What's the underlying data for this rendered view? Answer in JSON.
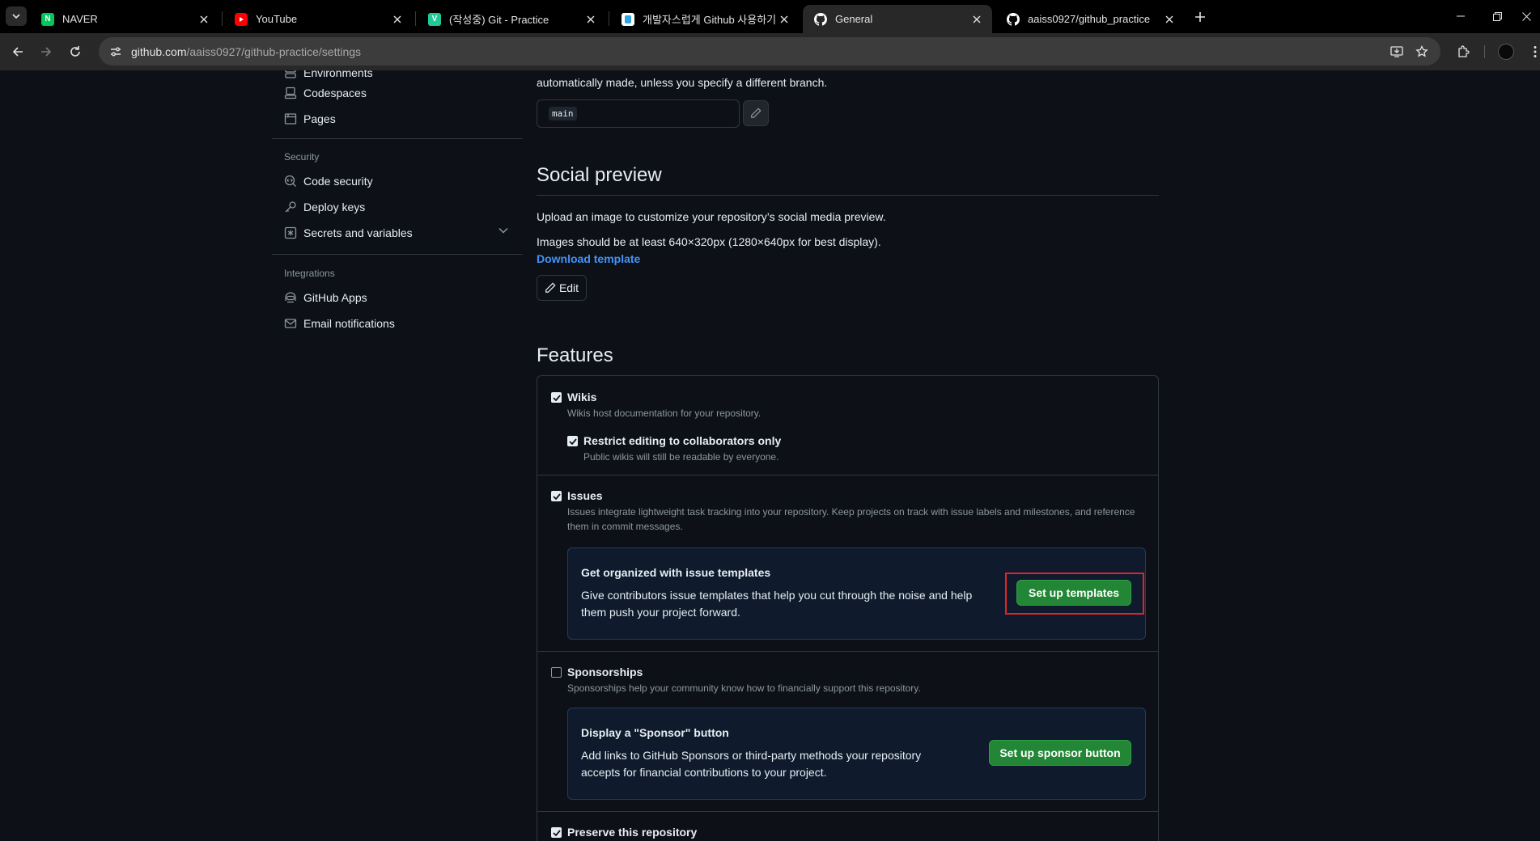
{
  "browser": {
    "tabs": [
      {
        "title": "NAVER",
        "favicon": "naver-icon",
        "color": "#03c75a",
        "active": false
      },
      {
        "title": "YouTube",
        "favicon": "youtube-icon",
        "color": "#ff0000",
        "active": false
      },
      {
        "title": "(작성중) Git - Practice",
        "favicon": "velog-icon",
        "color": "#20c997",
        "active": false
      },
      {
        "title": "개발자스럽게 Github 사용하기",
        "favicon": "blog-icon",
        "color": "#33a4e3",
        "active": false
      },
      {
        "title": "General",
        "favicon": "github-icon",
        "color": "#ffffff",
        "active": true
      },
      {
        "title": "aaiss0927/github_practice",
        "favicon": "github-icon",
        "color": "#ffffff",
        "active": false
      }
    ],
    "url_host": "github.com",
    "url_path": "/aaiss0927/github-practice/settings"
  },
  "sidebar": {
    "items_top": [
      {
        "label": "Environments",
        "icon": "server-icon"
      },
      {
        "label": "Codespaces",
        "icon": "codespaces-icon"
      },
      {
        "label": "Pages",
        "icon": "browser-icon"
      }
    ],
    "security_heading": "Security",
    "security_items": [
      {
        "label": "Code security",
        "icon": "codescan-icon"
      },
      {
        "label": "Deploy keys",
        "icon": "key-icon"
      },
      {
        "label": "Secrets and variables",
        "icon": "asterisk-icon"
      }
    ],
    "integrations_heading": "Integrations",
    "integration_items": [
      {
        "label": "GitHub Apps",
        "icon": "hubot-icon"
      },
      {
        "label": "Email notifications",
        "icon": "mail-icon"
      }
    ]
  },
  "default_branch": {
    "note": "automatically made, unless you specify a different branch.",
    "branch": "main"
  },
  "social_preview": {
    "title": "Social preview",
    "desc1": "Upload an image to customize your repository’s social media preview.",
    "desc2": "Images should be at least 640×320px (1280×640px for best display).",
    "download_link": "Download template",
    "edit_label": "Edit"
  },
  "features": {
    "title": "Features",
    "wikis": {
      "label": "Wikis",
      "checked": true,
      "desc": "Wikis host documentation for your repository.",
      "restrict_label": "Restrict editing to collaborators only",
      "restrict_desc": "Public wikis will still be readable by everyone."
    },
    "issues": {
      "label": "Issues",
      "checked": true,
      "desc": "Issues integrate lightweight task tracking into your repository. Keep projects on track with issue labels and milestones, and reference them in commit messages.",
      "promo_title": "Get organized with issue templates",
      "promo_body": "Give contributors issue templates that help you cut through the noise and help them push your project forward.",
      "button": "Set up templates"
    },
    "sponsorships": {
      "label": "Sponsorships",
      "checked": false,
      "desc": "Sponsorships help your community know how to financially support this repository.",
      "promo_title": "Display a \"Sponsor\" button",
      "promo_body": "Add links to GitHub Sponsors or third-party methods your repository accepts for financial contributions to your project.",
      "button": "Set up sponsor button"
    },
    "preserve": {
      "label": "Preserve this repository",
      "checked": true
    }
  }
}
